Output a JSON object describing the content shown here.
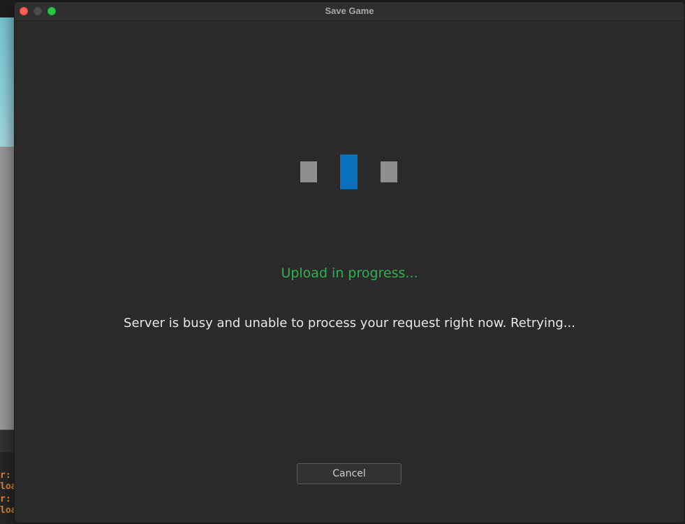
{
  "window": {
    "title": "Save Game"
  },
  "dialog": {
    "status_text": "Upload in progress...",
    "message_text": "Server is busy and unable to process your request right now. Retrying...",
    "cancel_label": "Cancel"
  },
  "background": {
    "output_lines": [
      "r:",
      "loa",
      "r:",
      "loa"
    ]
  },
  "colors": {
    "status_green": "#2fb24e",
    "loader_active": "#0a6fbd",
    "loader_idle": "#8f8f8f",
    "close_red": "#fe5f57",
    "maximize_green": "#2ac840"
  }
}
